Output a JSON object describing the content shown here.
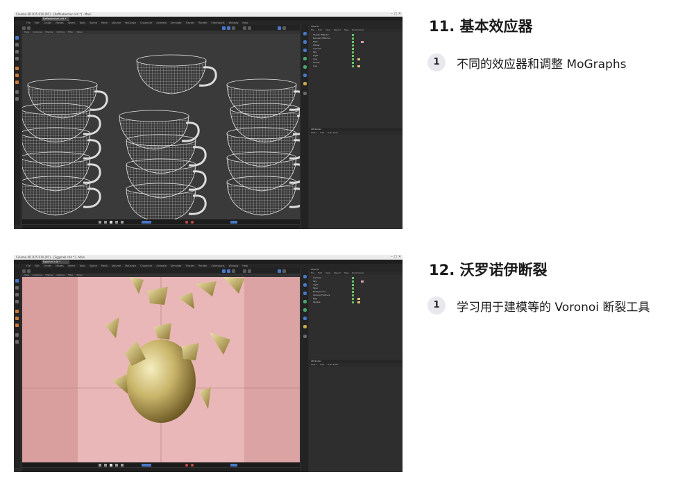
{
  "screenshots": [
    {
      "window_title": "Cinema 4D R25.010 (RC) - [Kaffeebecher.c4d *] - Main",
      "tabs": [
        "Kaffeebecher.c4d *"
      ],
      "menu": [
        "File",
        "Edit",
        "Create",
        "Modes",
        "Select",
        "Tools",
        "Spline",
        "Mesh",
        "Volume",
        "MoGraph",
        "Character",
        "Animate",
        "Simulate",
        "Tracker",
        "Render",
        "Extensions",
        "Window",
        "Help"
      ],
      "viewport_menu": [
        "View",
        "Cameras",
        "Display",
        "Options",
        "Filter",
        "Panel"
      ],
      "objects_header": "Objects",
      "objects_menu": [
        "File",
        "Edit",
        "View",
        "Object",
        "Tags",
        "Bookmarks"
      ],
      "objects": [
        "Shader Effector",
        "Random Effector",
        "Plain",
        "Cloner",
        "Camera",
        "Sky",
        "Light",
        "Cup",
        "Cloner",
        "Cup"
      ],
      "attributes_header": "Attributes",
      "attributes_menu": [
        "Mode",
        "Edit",
        "User Data"
      ]
    },
    {
      "window_title": "Cinema 4D R25.010 (RC) - [Eggshell.c4d *] - Main",
      "tabs": [
        "Eggshell.c4d *"
      ],
      "menu": [
        "File",
        "Edit",
        "Create",
        "Modes",
        "Select",
        "Tools",
        "Spline",
        "Mesh",
        "Volume",
        "MoGraph",
        "Character",
        "Animate",
        "Simulate",
        "Tracker",
        "Render",
        "Extensions",
        "Window",
        "Help"
      ],
      "viewport_menu": [
        "View",
        "Cameras",
        "Display",
        "Options",
        "Filter",
        "Panel"
      ],
      "objects_header": "Objects",
      "objects_menu": [
        "File",
        "Edit",
        "View",
        "Object",
        "Tags",
        "Bookmarks"
      ],
      "objects": [
        "Camera",
        "Sky",
        "Light",
        "Floor",
        "Background",
        "Voronoi Fracture",
        "Egg",
        "Sphere"
      ],
      "attributes_header": "Attributes",
      "attributes_menu": [
        "Mode",
        "Edit",
        "User Data"
      ]
    }
  ],
  "sections": [
    {
      "heading": "11. 基本效应器",
      "item_number": "1",
      "item_text": "不同的效应器和调整 MoGraphs"
    },
    {
      "heading": "12. 沃罗诺伊断裂",
      "item_number": "1",
      "item_text": "学习用于建模等的 Voronoi 断裂工具"
    }
  ],
  "colors": {
    "app_bg": "#2b2b2b",
    "wireframe_bg": "#3a3a3a",
    "wireframe_line": "#d8d8d8",
    "render_bg": "#e8b4b4",
    "gold": "#c9b56a",
    "badge_bg": "#e8e8ee"
  },
  "icons": [
    "minimize-icon",
    "maximize-icon",
    "close-icon",
    "play-icon",
    "record-icon",
    "move-tool-icon",
    "rotate-tool-icon",
    "scale-tool-icon"
  ]
}
